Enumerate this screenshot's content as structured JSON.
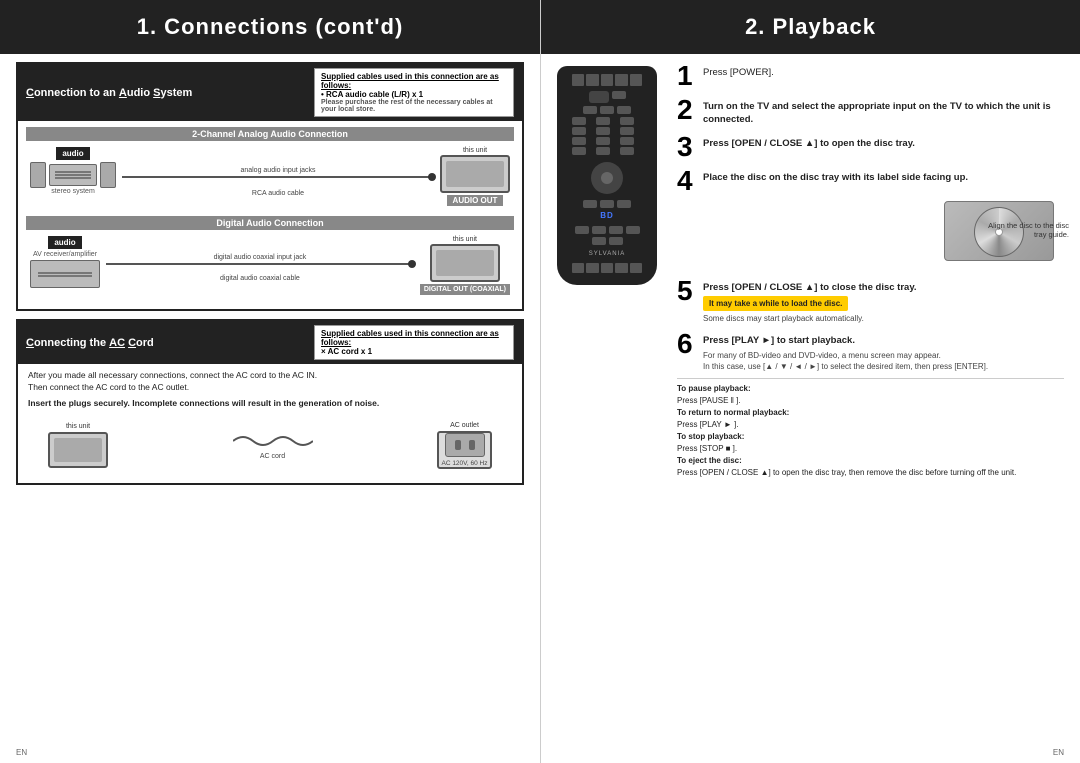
{
  "left": {
    "header": "1. Connections (cont'd)",
    "header_highlight": "C",
    "audio_system": {
      "title": "Connection to an Audio System",
      "title_highlights": [
        "C",
        "A",
        "S"
      ],
      "supplied_cables_title": "Supplied cables used in this connection are as follows:",
      "supplied_cables_items": [
        "• RCA audio cable (L/R) x 1",
        "Please purchase the rest of the necessary cables at your local store."
      ],
      "analog_section_label": "2-Channel Analog Audio Connection",
      "stereo_label": "stereo system",
      "analog_jacks_label": "analog audio input jacks",
      "rca_cable_label": "RCA audio cable",
      "this_unit_label1": "this unit",
      "audio_out_label": "AUDIO OUT",
      "digital_section_label": "Digital Audio Connection",
      "av_receiver_label": "AV receiver/amplifier",
      "digital_coaxial_label": "digital audio coaxial input jack",
      "digital_cable_label": "digital audio coaxial cable",
      "this_unit_label2": "this unit",
      "digital_out_label": "DIGITAL OUT (COAXIAL)"
    },
    "ac_cord": {
      "title": "Connecting the AC Cord",
      "title_highlight_AC": "AC",
      "title_highlight_C": "C",
      "supplied_cables_title": "Supplied cables used in this connection are as follows:",
      "supplied_cables_items": [
        "× AC cord x 1"
      ],
      "body_text1": "After you made all necessary connections, connect the AC cord to the AC IN.\nThen connect the AC cord to the AC outlet.",
      "body_text2": "Insert the plugs securely. Incomplete connections will result in the generation of noise.",
      "this_unit_label": "this unit",
      "ac_outlet_label": "AC outlet",
      "ac_cord_label": "AC cord",
      "voltage_label": "AC 120V, 60 Hz"
    }
  },
  "right": {
    "header": "2. Playback",
    "header_highlight": "P",
    "steps": [
      {
        "number": "1",
        "text": "Press [POWER]."
      },
      {
        "number": "2",
        "text": "Turn on the TV and select the appropriate input on the TV to which the unit is connected."
      },
      {
        "number": "3",
        "text": "Press [OPEN / CLOSE ▲] to open the disc tray."
      },
      {
        "number": "4",
        "text": "Place the disc on the disc tray with its label side facing up."
      },
      {
        "number": "5",
        "text": "Press [OPEN / CLOSE ▲] to close the disc tray.",
        "notice": "It may take a while to load the disc.",
        "sub_text": "Some discs may start playback automatically."
      },
      {
        "number": "6",
        "text": "Press [PLAY ►] to start playback.",
        "sub_text": "For many of BD-video and DVD-video, a menu screen may appear.\nIn this case, use [▲ / ▼ / ◄ / ►] to select the desired item, then press [ENTER]."
      }
    ],
    "press_commands": {
      "pause_title": "To pause playback:",
      "pause_cmd": "Press [PAUSE ‖ ].",
      "resume_title": "To return to normal playback:",
      "resume_cmd": "Press [PLAY ► ].",
      "stop_title": "To stop playback:",
      "stop_cmd": "Press [STOP ■ ].",
      "eject_title": "To eject the disc:",
      "eject_cmd": "Press [OPEN / CLOSE ▲] to open the disc tray, then remove the disc before turning off the unit."
    },
    "disc_tray_label": "Align the disc to the disc tray guide.",
    "brand": "SYLVANIA"
  },
  "page_numbers": {
    "left": "EN",
    "right": "EN"
  }
}
